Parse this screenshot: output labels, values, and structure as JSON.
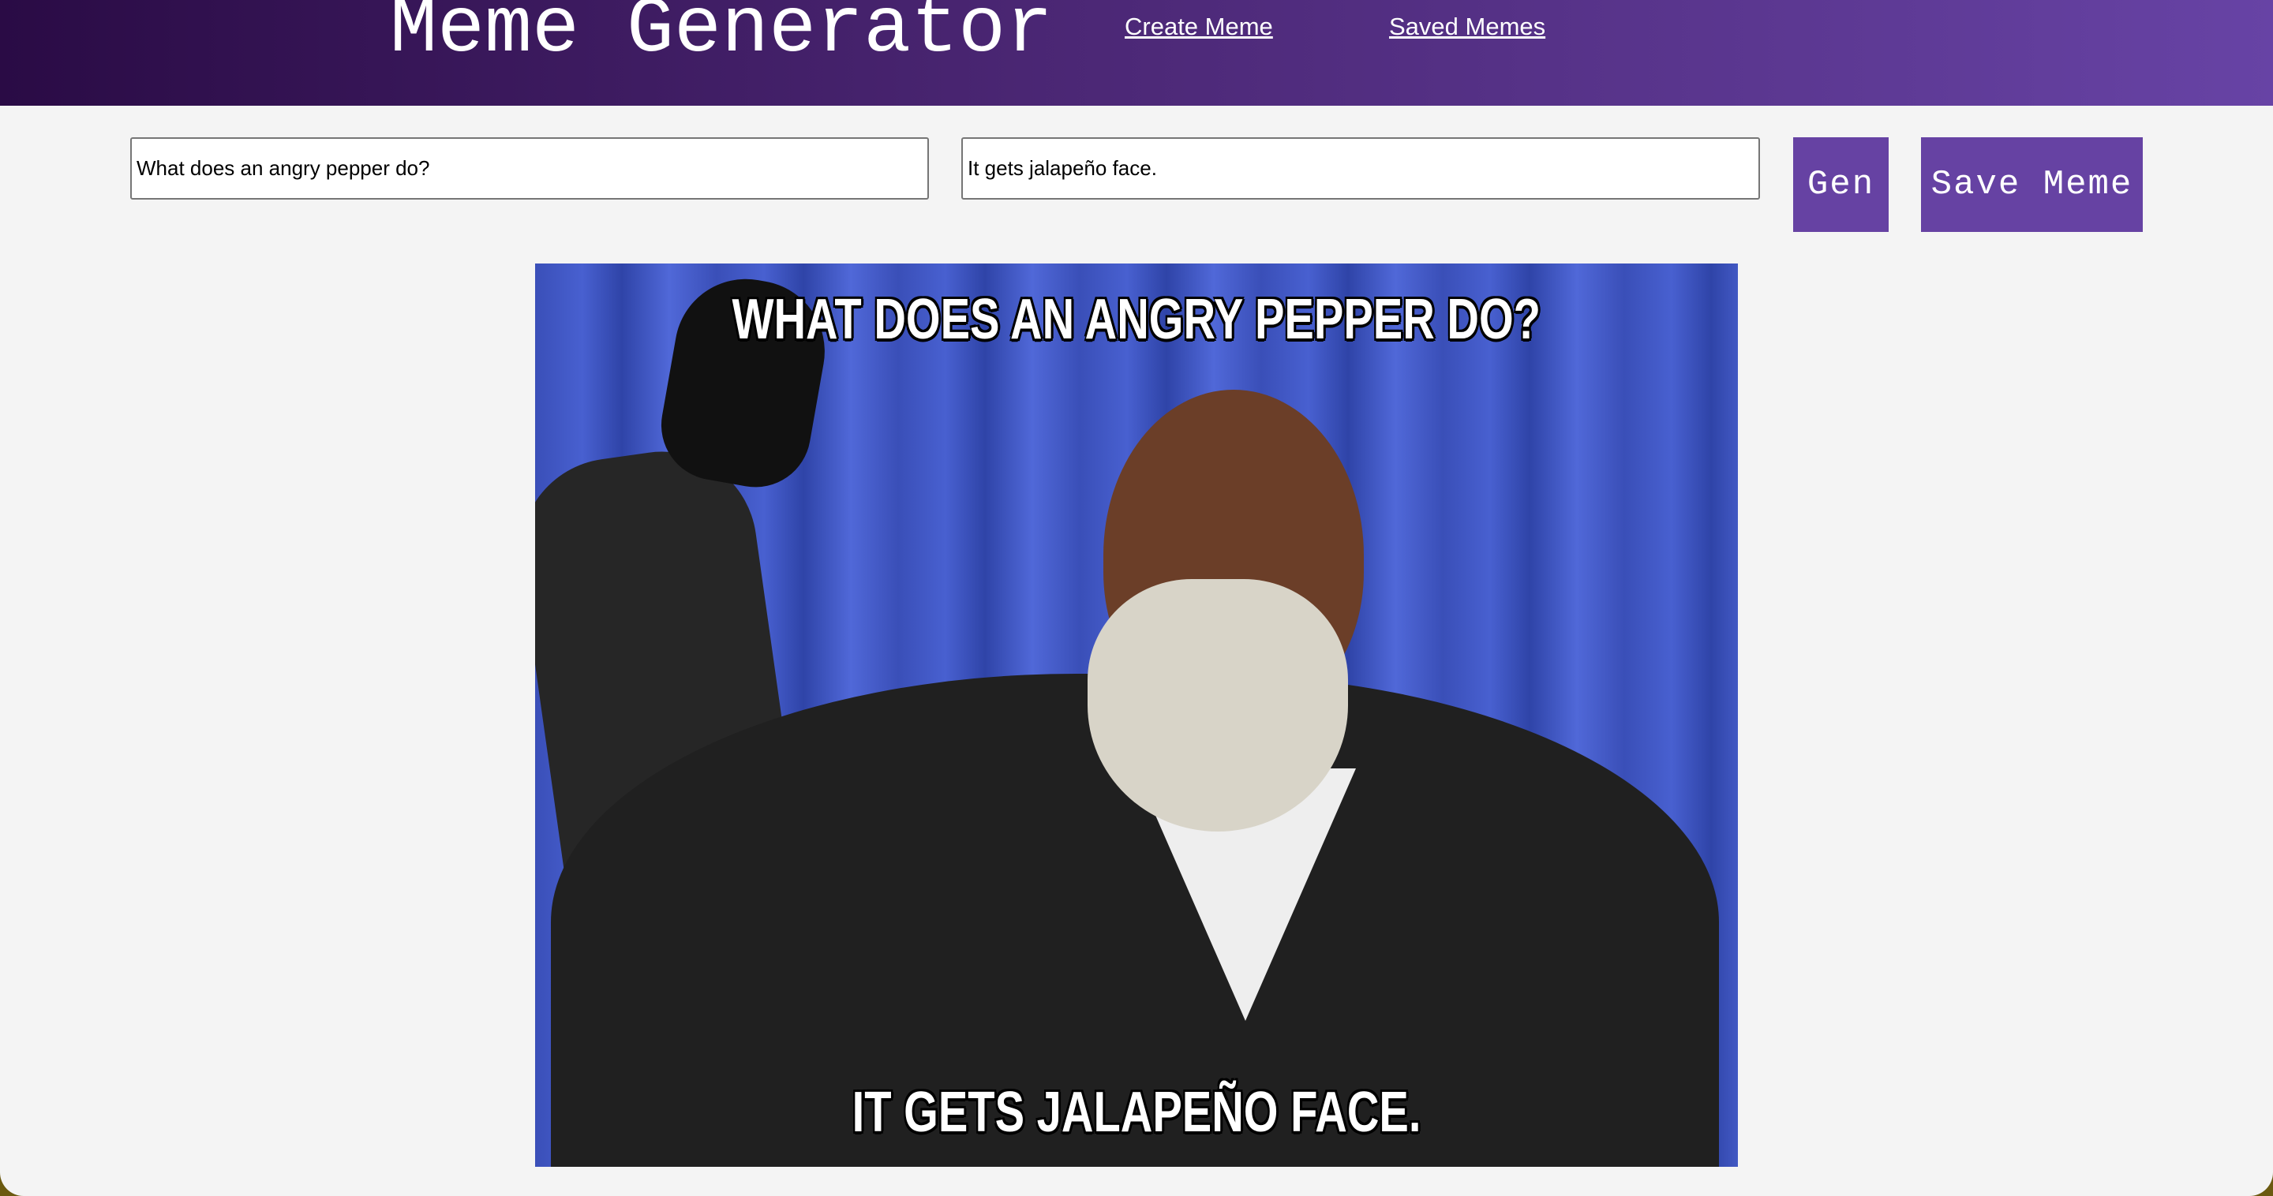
{
  "header": {
    "title": "Meme Generator",
    "nav": [
      "Create Meme",
      "Saved Memes"
    ]
  },
  "form": {
    "top_text": "What does an angry pepper do?",
    "bottom_text": "It gets jalapeño face.",
    "gen_label": "Gen",
    "save_label": "Save Meme"
  },
  "meme": {
    "top_caption": "WHAT DOES AN ANGRY PEPPER DO?",
    "bottom_caption": "IT GETS JALAPEÑO FACE."
  },
  "colors": {
    "accent": "#6642a3",
    "header_start": "#2a0b45",
    "header_end": "#6743a5"
  }
}
